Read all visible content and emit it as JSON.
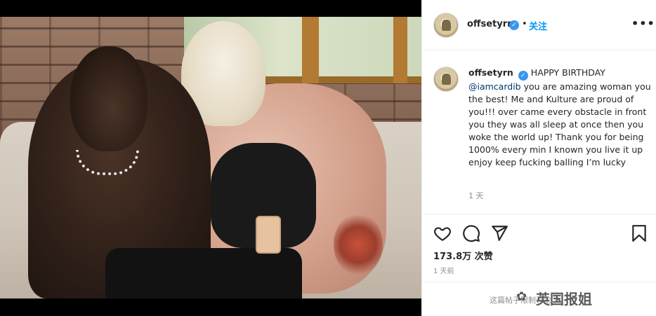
{
  "post": {
    "username": "offsetyrn",
    "verified_mark": "✓",
    "follow_label": "关注",
    "more_label": "•••",
    "separator": "•"
  },
  "caption": {
    "username": "offsetyrn",
    "verified_mark": "✓",
    "lead": "HAPPY BIRTHDAY",
    "mention": "@iamcardib",
    "body": "you are amazing woman you the best! Me and Kulture are proud of you!!! over came every obstacle in front you they was all sleep at once then you woke the world up! Thank you for being 1000% every min I known you live it up enjoy keep fucking balling I’m lucky",
    "ago": "1 天"
  },
  "actions": {
    "like_icon": "heart-icon",
    "comment_icon": "comment-icon",
    "share_icon": "paper-plane-icon",
    "save_icon": "bookmark-icon"
  },
  "stats": {
    "likes": "173.8万 次赞",
    "date": "1 天前"
  },
  "comments": {
    "restricted_message": "这篇帖子限制评论了。"
  },
  "watermark": {
    "text": "英国报姐",
    "icon": "wechat-icon"
  },
  "colors": {
    "link_blue": "#0095f6",
    "verified_blue": "#3897f0",
    "muted_gray": "#8e8e8e"
  }
}
